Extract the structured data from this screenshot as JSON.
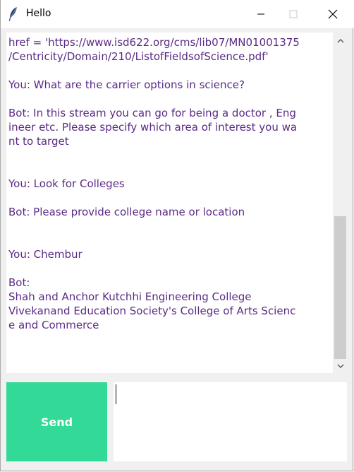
{
  "window": {
    "title": "Hello",
    "icons": {
      "app": "feather-icon",
      "minimize": "minimize-icon",
      "maximize": "maximize-icon",
      "close": "close-icon"
    }
  },
  "chat": {
    "text_color": "#5b2a86",
    "lines": [
      "href = 'https://www.isd622.org/cms/lib07/MN01001375",
      "/Centricity/Domain/210/ListofFieldsofScience.pdf'",
      "",
      "You: What are the carrier options in science?",
      "",
      "Bot: In this stream you can go for being a doctor , Eng",
      "ineer etc. Please specify which area of interest you wa",
      "nt to target",
      "",
      "",
      "You: Look for Colleges",
      "",
      "Bot: Please provide college name or location",
      "",
      "",
      "You: Chembur",
      "",
      "Bot:",
      "Shah and Anchor Kutchhi Engineering College",
      "Vivekanand Education Society's College of Arts Scienc",
      "e and Commerce"
    ]
  },
  "scrollbar": {
    "up_icon": "chevron-up-icon",
    "down_icon": "chevron-down-icon"
  },
  "send_button": {
    "label": "Send",
    "color": "#33d996"
  },
  "message_input": {
    "value": ""
  }
}
